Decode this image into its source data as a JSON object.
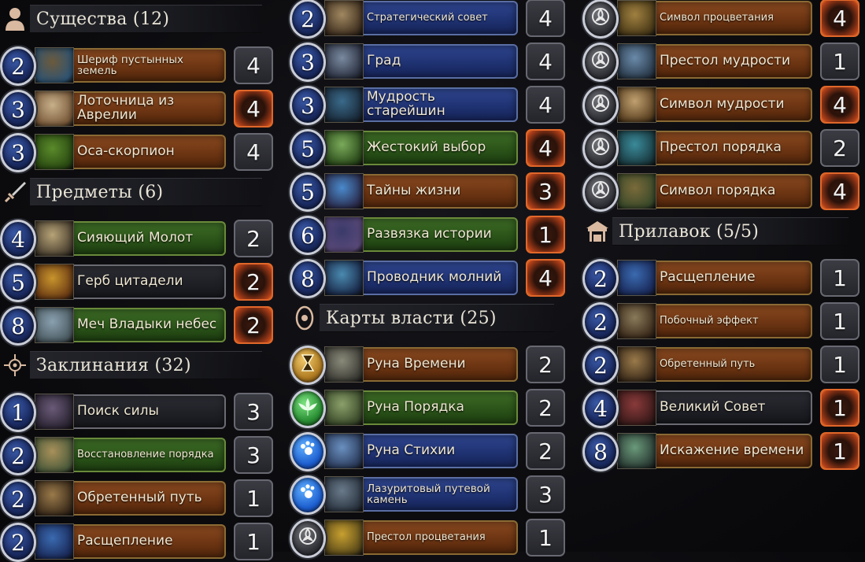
{
  "columns": [
    {
      "items": [
        {
          "kind": "section",
          "icon": "creature-icon",
          "title": "Существа (12)"
        },
        {
          "kind": "card",
          "cost": "2",
          "name": "Шериф пустынных земель",
          "frame": "orange",
          "count": "4",
          "hot": false,
          "art": [
            "#6b5a3c",
            "#2e5474"
          ],
          "two": true
        },
        {
          "kind": "card",
          "cost": "3",
          "name": "Лоточница из Аврелии",
          "frame": "orange",
          "count": "4",
          "hot": true,
          "art": [
            "#c7b08a",
            "#7a5a3a"
          ]
        },
        {
          "kind": "card",
          "cost": "3",
          "name": "Оса-скорпион",
          "frame": "orange",
          "count": "4",
          "hot": false,
          "art": [
            "#5a8a2a",
            "#2a4a12"
          ]
        },
        {
          "kind": "section",
          "icon": "sword-icon",
          "title": "Предметы (6)"
        },
        {
          "kind": "card",
          "cost": "4",
          "name": "Сияющий Молот",
          "frame": "green",
          "count": "2",
          "hot": false,
          "art": [
            "#b7a377",
            "#4a4030"
          ]
        },
        {
          "kind": "card",
          "cost": "5",
          "name": "Герб цитадели",
          "frame": "dark",
          "count": "2",
          "hot": true,
          "art": [
            "#c8942c",
            "#6a3a14"
          ]
        },
        {
          "kind": "card",
          "cost": "8",
          "name": "Меч Владыки небес",
          "frame": "green",
          "count": "2",
          "hot": true,
          "art": [
            "#8aa0b0",
            "#4a5a60"
          ]
        },
        {
          "kind": "section",
          "icon": "spell-icon",
          "title": "Заклинания (32)"
        },
        {
          "kind": "card",
          "cost": "1",
          "name": "Поиск силы",
          "frame": "dark",
          "count": "3",
          "hot": false,
          "art": [
            "#6a5a78",
            "#2a2432"
          ]
        },
        {
          "kind": "card",
          "cost": "2",
          "name": "Восстановление порядка",
          "frame": "green",
          "count": "3",
          "hot": false,
          "art": [
            "#a8905a",
            "#4a5a3a"
          ],
          "small": true
        },
        {
          "kind": "card",
          "cost": "2",
          "name": "Обретенный путь",
          "frame": "orange",
          "count": "1",
          "hot": false,
          "art": [
            "#9a7a4a",
            "#3a2a1a"
          ]
        },
        {
          "kind": "card",
          "cost": "2",
          "name": "Расщепление",
          "frame": "orange",
          "count": "1",
          "hot": false,
          "art": [
            "#3a6ab0",
            "#1a2a5a"
          ]
        }
      ]
    },
    {
      "items": [
        {
          "kind": "card",
          "cost": "2",
          "name": "Стратегический совет",
          "frame": "blue",
          "count": "4",
          "hot": false,
          "art": [
            "#a08860",
            "#403020"
          ],
          "small": true,
          "partial": true
        },
        {
          "kind": "card",
          "cost": "3",
          "name": "Град",
          "frame": "blue",
          "count": "4",
          "hot": false,
          "art": [
            "#7a8aa0",
            "#2a3040"
          ]
        },
        {
          "kind": "card",
          "cost": "3",
          "name": "Мудрость старейшин",
          "frame": "blue",
          "count": "4",
          "hot": false,
          "art": [
            "#3a6a8a",
            "#1a2a3a"
          ]
        },
        {
          "kind": "card",
          "cost": "5",
          "name": "Жестокий выбор",
          "frame": "green",
          "count": "4",
          "hot": true,
          "art": [
            "#7aaa5a",
            "#2a4a1a"
          ]
        },
        {
          "kind": "card",
          "cost": "5",
          "name": "Тайны жизни",
          "frame": "orange",
          "count": "3",
          "hot": true,
          "art": [
            "#4a8acc",
            "#2a2a4a"
          ]
        },
        {
          "kind": "card",
          "cost": "6",
          "name": "Развязка истории",
          "frame": "green",
          "count": "1",
          "hot": true,
          "art": [
            "#3a3a6a",
            "#5a4a7a"
          ]
        },
        {
          "kind": "card",
          "cost": "8",
          "name": "Проводник молний",
          "frame": "blue",
          "count": "4",
          "hot": true,
          "art": [
            "#4a8ab0",
            "#1a2a4a"
          ]
        },
        {
          "kind": "section",
          "icon": "power-card-icon",
          "title": "Карты власти (25)"
        },
        {
          "kind": "card",
          "rune": "time",
          "name": "Руна Времени",
          "frame": "orange",
          "count": "2",
          "hot": false,
          "art": [
            "#8a8a7a",
            "#3a3a34"
          ],
          "runeart": true
        },
        {
          "kind": "card",
          "rune": "order",
          "name": "Руна Порядка",
          "frame": "green",
          "count": "2",
          "hot": false,
          "art": [
            "#8aa06a",
            "#3a4a2a"
          ],
          "runeart": true
        },
        {
          "kind": "card",
          "rune": "elem",
          "name": "Руна Стихии",
          "frame": "blue",
          "count": "2",
          "hot": false,
          "art": [
            "#6a90c0",
            "#2a3a5a"
          ],
          "runeart": true
        },
        {
          "kind": "card",
          "rune": "elem",
          "name": "Лазуритовый путевой камень",
          "frame": "blue",
          "count": "3",
          "hot": false,
          "art": [
            "#6a7a8a",
            "#2a3440"
          ],
          "two": true
        },
        {
          "kind": "card",
          "rune": "sym",
          "name": "Престол процветания",
          "frame": "orange",
          "count": "1",
          "hot": false,
          "art": [
            "#c8a030",
            "#5a4a1a"
          ],
          "small": true
        }
      ]
    },
    {
      "items": [
        {
          "kind": "card",
          "rune": "sym",
          "name": "Символ процветания",
          "frame": "orange",
          "count": "4",
          "hot": true,
          "art": [
            "#a08040",
            "#4a3a18"
          ],
          "small": true,
          "partial": true
        },
        {
          "kind": "card",
          "rune": "sym",
          "name": "Престол мудрости",
          "frame": "orange",
          "count": "1",
          "hot": false,
          "art": [
            "#6a8aaa",
            "#2a3a4a"
          ]
        },
        {
          "kind": "card",
          "rune": "sym",
          "name": "Символ мудрости",
          "frame": "orange",
          "count": "4",
          "hot": true,
          "art": [
            "#c0a070",
            "#5a4020"
          ]
        },
        {
          "kind": "card",
          "rune": "sym",
          "name": "Престол порядка",
          "frame": "orange",
          "count": "2",
          "hot": false,
          "art": [
            "#3a8a9a",
            "#1a3a40"
          ]
        },
        {
          "kind": "card",
          "rune": "sym",
          "name": "Символ порядка",
          "frame": "orange",
          "count": "4",
          "hot": true,
          "art": [
            "#7a6a3a",
            "#3a4a2a"
          ]
        },
        {
          "kind": "section",
          "icon": "shop-icon",
          "title": "Прилавок (5/5)"
        },
        {
          "kind": "card",
          "cost": "2",
          "name": "Расщепление",
          "frame": "orange",
          "count": "1",
          "hot": false,
          "art": [
            "#3a6ab0",
            "#1a2a5a"
          ]
        },
        {
          "kind": "card",
          "cost": "2",
          "name": "Побочный эффект",
          "frame": "orange",
          "count": "1",
          "hot": false,
          "art": [
            "#8a7a5a",
            "#3a2a1a"
          ],
          "small": true
        },
        {
          "kind": "card",
          "cost": "2",
          "name": "Обретенный путь",
          "frame": "orange",
          "count": "1",
          "hot": false,
          "art": [
            "#9a7a4a",
            "#3a2a1a"
          ],
          "small": true
        },
        {
          "kind": "card",
          "cost": "4",
          "name": "Великий Совет",
          "frame": "dark",
          "count": "1",
          "hot": true,
          "art": [
            "#8a3a3a",
            "#3a1a1a"
          ]
        },
        {
          "kind": "card",
          "cost": "8",
          "name": "Искажение времени",
          "frame": "orange",
          "count": "1",
          "hot": true,
          "art": [
            "#6a9a7a",
            "#2a3a34"
          ]
        }
      ]
    }
  ]
}
